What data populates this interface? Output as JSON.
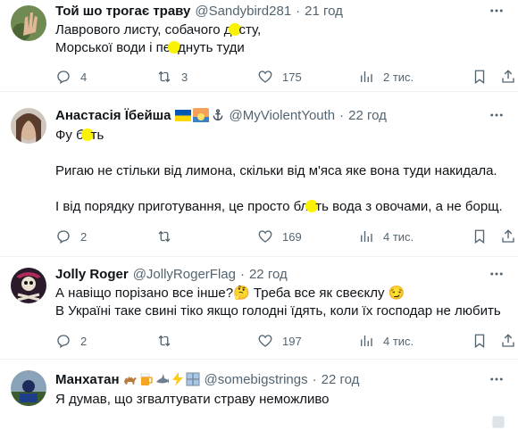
{
  "colors": {
    "text": "#0f1419",
    "secondary": "#536471",
    "divider": "#eff3f4",
    "censor": "#f9f200"
  },
  "tweets": [
    {
      "name": "Той шо трогає траву",
      "handle": "@Sandybird281",
      "sep": "·",
      "time": "21 год",
      "lines": [
        "Лаврового листу, собачого д_сту,",
        "Морської води і пе_днуть туди"
      ],
      "replies": "4",
      "retweets": "3",
      "likes": "175",
      "views": "2 тис."
    },
    {
      "name": "Анастасія Їбейша",
      "handle": "@MyViolentYouth",
      "sep": "·",
      "time": "22 год",
      "lines": [
        "Фу б_ть",
        "",
        "Ригаю не стільки від лимона, скільки від м'яса яке вона туди накидала.",
        "",
        "І від порядку приготування, це просто бл_ть вода з овочами, а не борщ."
      ],
      "replies": "2",
      "retweets": "",
      "likes": "169",
      "views": "4 тис."
    },
    {
      "name": "Jolly Roger",
      "handle": "@JollyRogerFlag",
      "sep": "·",
      "time": "22 год",
      "lines": [
        "А навіщо порізано все інше?🤔 Треба все як свеєклу 😏",
        "В Україні таке свині тіко якщо голодні їдять, коли їх господар не любить"
      ],
      "replies": "2",
      "retweets": "",
      "likes": "197",
      "views": "4 тис."
    },
    {
      "name": "Манхатан",
      "handle": "@somebigstrings",
      "sep": "·",
      "time": "22 год",
      "lines": [
        "Я думав, що згвалтувати страву неможливо"
      ]
    }
  ],
  "icons": [
    "reply-icon",
    "retweet-icon",
    "like-icon",
    "views-icon",
    "bookmark-icon",
    "share-icon",
    "more-icon",
    "verified-icon"
  ]
}
